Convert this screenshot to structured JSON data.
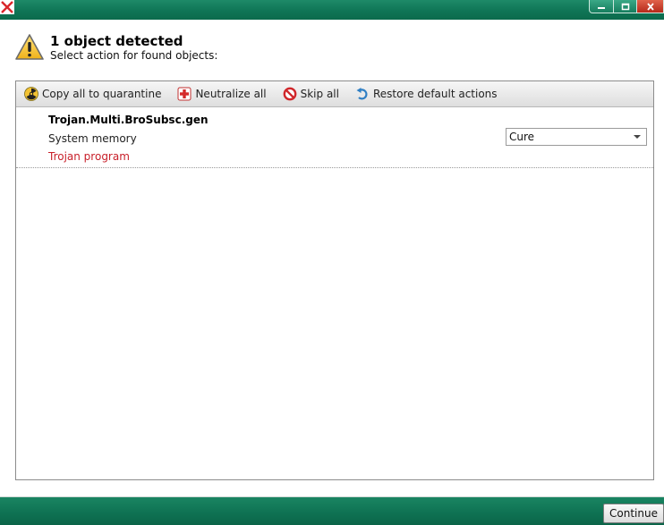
{
  "window": {
    "title_icon": "kaspersky-app-icon",
    "controls": [
      "minimize-icon",
      "maximize-icon",
      "close-icon"
    ]
  },
  "header": {
    "title": "1 object detected",
    "subtitle": "Select action for found objects:",
    "icon": "warning-icon"
  },
  "toolbar": {
    "items": [
      {
        "label": "Copy all to quarantine",
        "icon": "radiation-icon"
      },
      {
        "label": "Neutralize all",
        "icon": "medical-cross-icon"
      },
      {
        "label": "Skip all",
        "icon": "prohibited-icon"
      },
      {
        "label": "Restore default actions",
        "icon": "undo-arrow-icon"
      }
    ]
  },
  "objects": [
    {
      "name": "Trojan.Multi.BroSubsc.gen",
      "location": "System memory",
      "type": "Trojan program",
      "action": "Cure"
    }
  ],
  "footer": {
    "continue_label": "Continue"
  },
  "colors": {
    "titlebar": "#0f7556",
    "threat_type": "#c8202a",
    "close_button": "#c53a26"
  }
}
